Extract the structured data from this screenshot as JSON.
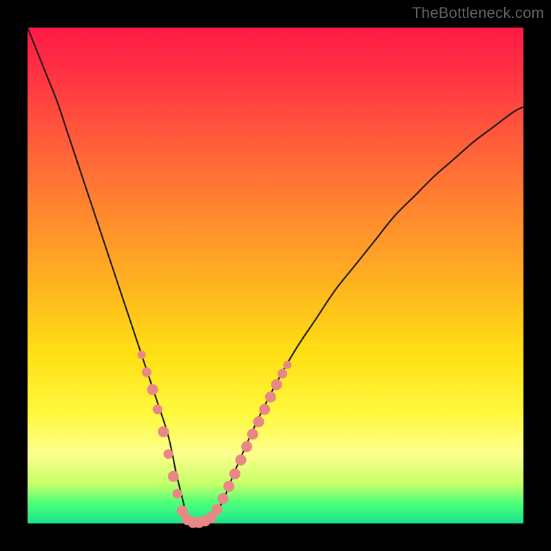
{
  "watermark": "TheBottleneck.com",
  "chart_data": {
    "type": "line",
    "title": "",
    "xlabel": "",
    "ylabel": "",
    "xlim": [
      0,
      100
    ],
    "ylim": [
      0,
      100
    ],
    "grid": false,
    "legend": false,
    "curve": {
      "description": "V-shaped bottleneck curve",
      "x": [
        0,
        2,
        4,
        6,
        8,
        10,
        12,
        14,
        16,
        18,
        20,
        22,
        24,
        26,
        28,
        29,
        30,
        31,
        32,
        33,
        34,
        36,
        38,
        40,
        42,
        46,
        50,
        54,
        58,
        62,
        66,
        70,
        74,
        78,
        82,
        86,
        90,
        94,
        98,
        100
      ],
      "y": [
        100,
        95,
        90,
        85,
        79,
        73,
        67,
        61,
        55,
        49,
        43,
        37,
        31,
        25,
        19,
        15,
        10,
        6,
        2,
        0.3,
        0,
        0.3,
        2,
        6,
        11,
        20,
        28,
        35,
        41,
        47,
        52,
        57,
        62,
        66,
        70,
        73.5,
        77,
        80,
        83,
        84
      ]
    },
    "markers": {
      "description": "Highlighted sample points along the curve near the valley",
      "points": [
        {
          "x": 23.0,
          "y": 34.0,
          "r": 6
        },
        {
          "x": 24.0,
          "y": 30.5,
          "r": 7
        },
        {
          "x": 25.2,
          "y": 27.0,
          "r": 8
        },
        {
          "x": 26.2,
          "y": 23.0,
          "r": 7
        },
        {
          "x": 27.4,
          "y": 18.5,
          "r": 8
        },
        {
          "x": 28.4,
          "y": 14.0,
          "r": 7
        },
        {
          "x": 29.4,
          "y": 9.5,
          "r": 8
        },
        {
          "x": 30.2,
          "y": 6.0,
          "r": 7
        },
        {
          "x": 31.2,
          "y": 2.5,
          "r": 8
        },
        {
          "x": 32.2,
          "y": 0.8,
          "r": 8
        },
        {
          "x": 33.4,
          "y": 0.2,
          "r": 8
        },
        {
          "x": 34.6,
          "y": 0.2,
          "r": 8
        },
        {
          "x": 35.8,
          "y": 0.5,
          "r": 8
        },
        {
          "x": 37.0,
          "y": 1.2,
          "r": 8
        },
        {
          "x": 38.2,
          "y": 2.8,
          "r": 8
        },
        {
          "x": 39.4,
          "y": 5.0,
          "r": 8
        },
        {
          "x": 40.6,
          "y": 7.5,
          "r": 8
        },
        {
          "x": 41.8,
          "y": 10.0,
          "r": 8
        },
        {
          "x": 43.0,
          "y": 12.8,
          "r": 8
        },
        {
          "x": 44.2,
          "y": 15.5,
          "r": 8
        },
        {
          "x": 45.4,
          "y": 18.0,
          "r": 8
        },
        {
          "x": 46.6,
          "y": 20.5,
          "r": 8
        },
        {
          "x": 47.8,
          "y": 23.0,
          "r": 8
        },
        {
          "x": 49.0,
          "y": 25.5,
          "r": 8
        },
        {
          "x": 50.2,
          "y": 28.0,
          "r": 8
        },
        {
          "x": 51.4,
          "y": 30.2,
          "r": 7
        },
        {
          "x": 52.4,
          "y": 32.0,
          "r": 6
        }
      ]
    },
    "gradient_stops": [
      {
        "pos": 0.0,
        "color": "#ff1a47"
      },
      {
        "pos": 0.22,
        "color": "#ff5a3c"
      },
      {
        "pos": 0.52,
        "color": "#ffb41f"
      },
      {
        "pos": 0.78,
        "color": "#fff93f"
      },
      {
        "pos": 0.92,
        "color": "#c6ff68"
      },
      {
        "pos": 1.0,
        "color": "#1be38c"
      }
    ]
  }
}
